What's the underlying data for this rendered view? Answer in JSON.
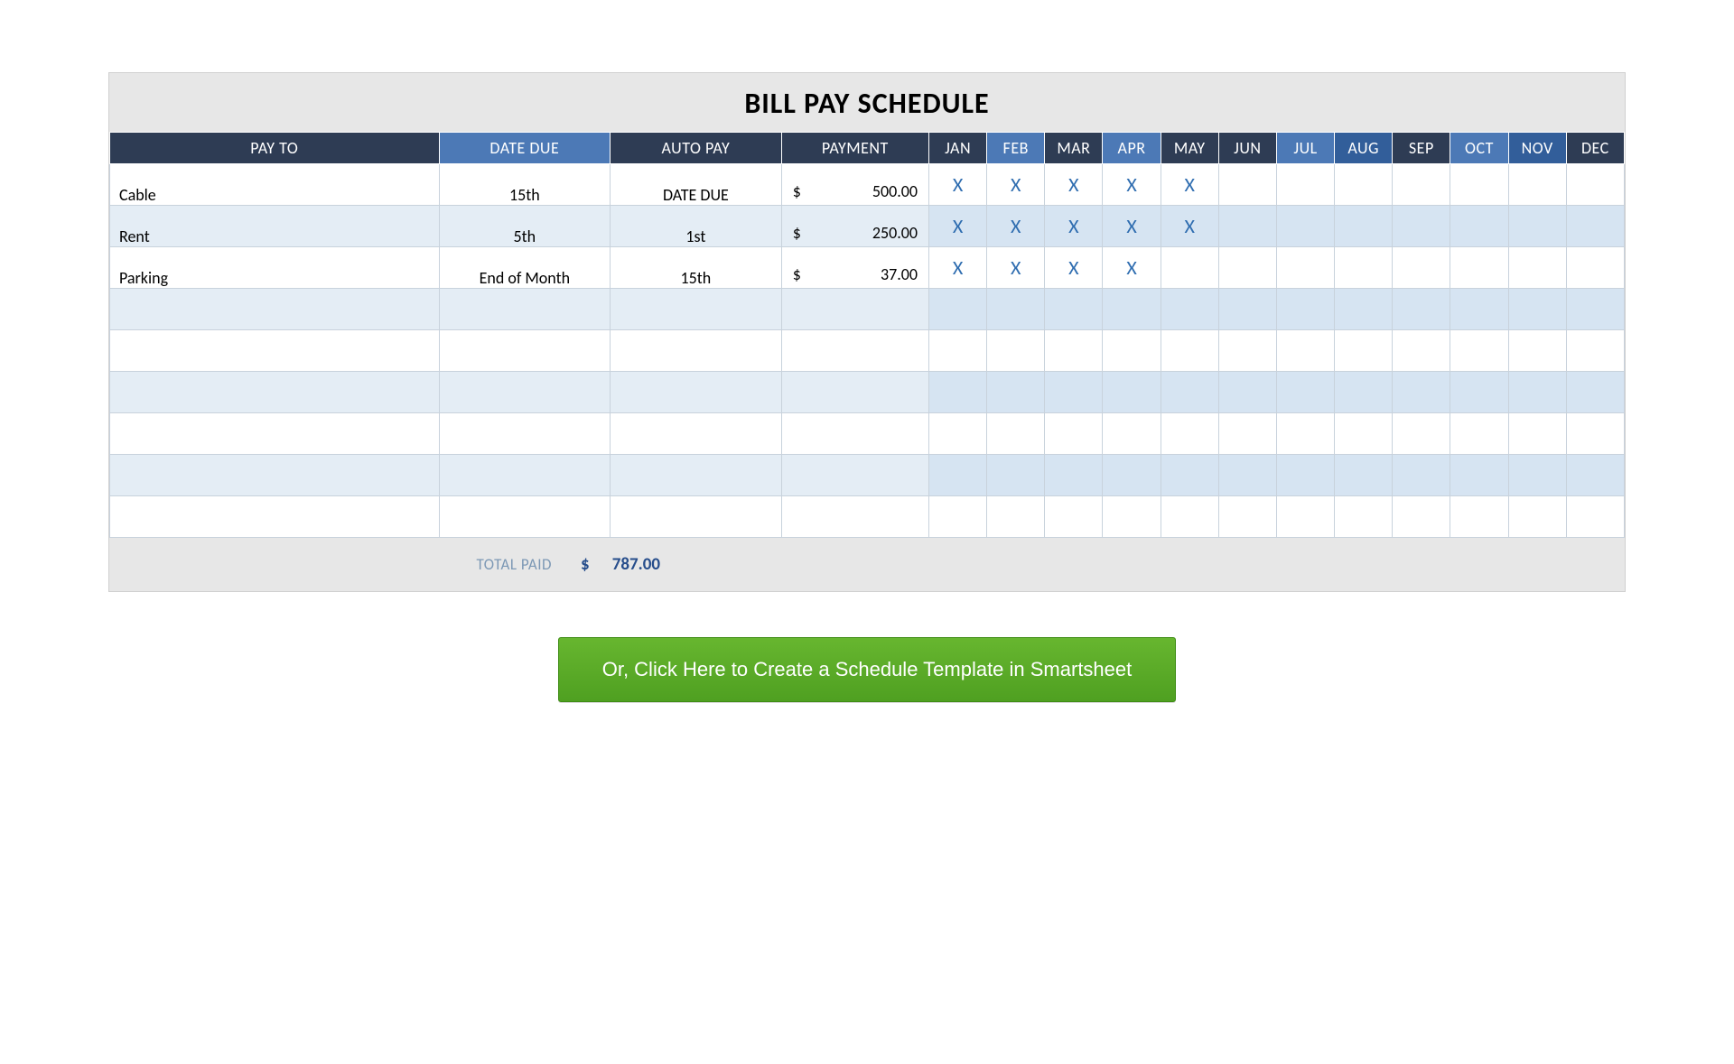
{
  "title": "BILL PAY SCHEDULE",
  "headers": {
    "pay_to": "PAY TO",
    "date_due": "DATE DUE",
    "auto_pay": "AUTO PAY",
    "payment": "PAYMENT"
  },
  "months": [
    "JAN",
    "FEB",
    "MAR",
    "APR",
    "MAY",
    "JUN",
    "JUL",
    "AUG",
    "SEP",
    "OCT",
    "NOV",
    "DEC"
  ],
  "x_mark": "X",
  "currency": "$",
  "rows": [
    {
      "pay_to": "Cable",
      "date_due": "15th",
      "auto_pay": "DATE DUE",
      "payment": "500.00",
      "checks": [
        true,
        true,
        true,
        true,
        true,
        false,
        false,
        false,
        false,
        false,
        false,
        false
      ]
    },
    {
      "pay_to": "Rent",
      "date_due": "5th",
      "auto_pay": "1st",
      "payment": "250.00",
      "checks": [
        true,
        true,
        true,
        true,
        true,
        false,
        false,
        false,
        false,
        false,
        false,
        false
      ]
    },
    {
      "pay_to": "Parking",
      "date_due": "End of Month",
      "auto_pay": "15th",
      "payment": "37.00",
      "checks": [
        true,
        true,
        true,
        true,
        false,
        false,
        false,
        false,
        false,
        false,
        false,
        false
      ]
    },
    {
      "pay_to": "",
      "date_due": "",
      "auto_pay": "",
      "payment": "",
      "checks": [
        false,
        false,
        false,
        false,
        false,
        false,
        false,
        false,
        false,
        false,
        false,
        false
      ]
    },
    {
      "pay_to": "",
      "date_due": "",
      "auto_pay": "",
      "payment": "",
      "checks": [
        false,
        false,
        false,
        false,
        false,
        false,
        false,
        false,
        false,
        false,
        false,
        false
      ]
    },
    {
      "pay_to": "",
      "date_due": "",
      "auto_pay": "",
      "payment": "",
      "checks": [
        false,
        false,
        false,
        false,
        false,
        false,
        false,
        false,
        false,
        false,
        false,
        false
      ]
    },
    {
      "pay_to": "",
      "date_due": "",
      "auto_pay": "",
      "payment": "",
      "checks": [
        false,
        false,
        false,
        false,
        false,
        false,
        false,
        false,
        false,
        false,
        false,
        false
      ]
    },
    {
      "pay_to": "",
      "date_due": "",
      "auto_pay": "",
      "payment": "",
      "checks": [
        false,
        false,
        false,
        false,
        false,
        false,
        false,
        false,
        false,
        false,
        false,
        false
      ]
    },
    {
      "pay_to": "",
      "date_due": "",
      "auto_pay": "",
      "payment": "",
      "checks": [
        false,
        false,
        false,
        false,
        false,
        false,
        false,
        false,
        false,
        false,
        false,
        false
      ]
    }
  ],
  "total": {
    "label": "TOTAL PAID",
    "value": "787.00"
  },
  "cta": "Or, Click Here to Create a Schedule Template in Smartsheet",
  "header_styles": [
    "h-dark",
    "h-blue",
    "h-dark",
    "h-blue",
    "h-dark",
    "h-dark",
    "h-blue",
    "h-alt",
    "h-dark",
    "h-blue",
    "h-alt",
    "h-dark"
  ]
}
